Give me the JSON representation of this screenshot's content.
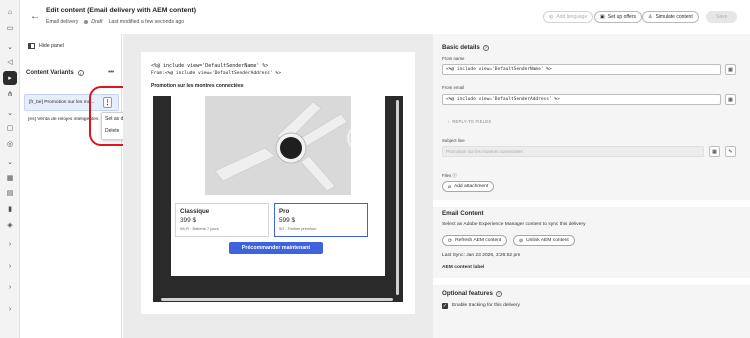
{
  "rail": {
    "icons": [
      "home-icon",
      "box-search-icon",
      "chevron-icon",
      "megaphone-icon",
      "journey-icon",
      "flow-icon",
      "chevron-icon",
      "message-icon",
      "offer-icon",
      "chevron-icon",
      "calendar-icon",
      "folder-icon",
      "chart-icon",
      "shield-icon",
      "chevron-right-icon",
      "chevron-right-icon",
      "chevron-right-icon",
      "chevron-right-icon"
    ],
    "active_index": 4
  },
  "header": {
    "title": "Edit content (Email delivery with AEM content)",
    "channel": "Email delivery",
    "status": "Draft",
    "modified": "Last modified a few seconds ago",
    "add_language": "Add language",
    "set_up_offers": "Set up offers",
    "simulate": "Simulate content",
    "save": "Save"
  },
  "left_panel": {
    "hide_panel": "Hide panel",
    "title": "Content Variants",
    "variants": [
      "[fr_be] Promotion sur les mo...",
      "[es] Venta de relojes inteligentes"
    ],
    "menu": [
      "Set as default",
      "Delete"
    ]
  },
  "preview": {
    "code1": "<%@ include view='DefaultSenderName' %>",
    "code2": "From:<%@ include view='DefaultSenderAddress' %>",
    "subject": "Promotion sur les montres connectées",
    "cards": [
      {
        "name": "Classique",
        "price": "399 $",
        "desc": "Wi-Fi · Batterie 7 jours"
      },
      {
        "name": "Pro",
        "price": "599 $",
        "desc": "5G · Finition premium"
      }
    ],
    "cta": "Précommander maintenant"
  },
  "right_panel": {
    "basic_details": "Basic details",
    "from_name_label": "From name",
    "from_name_value": "<%@ include view='DefaultSenderName' %>",
    "from_email_label": "From email",
    "from_email_value": "<%@ include view='DefaultSenderAddress' %>",
    "reply_to": "REPLY-TO FIELDS",
    "subject_label": "Subject line",
    "subject_placeholder": "Promotion sur les montres connectées",
    "files_label": "Files",
    "add_attachment": "Add attachment",
    "email_content": "Email Content",
    "email_content_desc": "Select an Adobe Experience Manager content to sync this delivery",
    "refresh_aem": "Refresh AEM content",
    "unlink_aem": "Unlink AEM content",
    "last_sync": "Last Sync: Jan 23 2026, 3:26:52 pm",
    "aem_label": "AEM content label",
    "optional_features": "Optional features",
    "enable_tracking": "Enable tracking for this delivery"
  }
}
